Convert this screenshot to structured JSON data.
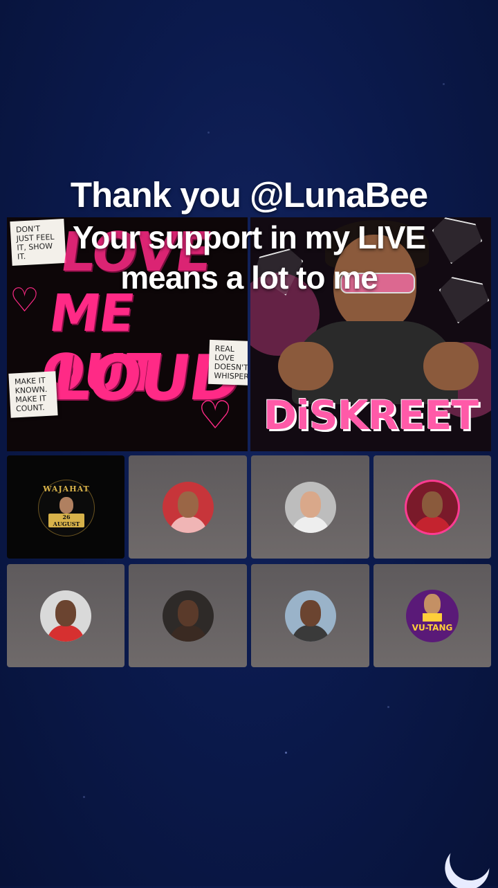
{
  "overlay": {
    "thank_you": "Thank you @LunaBee",
    "support_message": "Your support in my LIVE means a lot to me"
  },
  "left_tile": {
    "note_top": "DON'T JUST FEEL IT, SHOW IT.",
    "note_mid": "REAL LOVE DOESN'T WHISPER.",
    "note_bottom": "MAKE IT KNOWN. MAKE IT COUNT.",
    "headline_1": "LOVE",
    "headline_2": "ME OUT",
    "headline_3": "LOUD"
  },
  "right_tile": {
    "brand": "DiSKREET"
  },
  "guests": [
    {
      "type": "poster",
      "name": "WAJAHAT",
      "date": "26 AUGUST"
    },
    {
      "type": "avatar",
      "skin": "#9a6646",
      "top": "#f0b5b5",
      "bg": "#c7353a"
    },
    {
      "type": "avatar",
      "skin": "#d9a88a",
      "top": "#eeeeee",
      "bg": "#bdbdbd"
    },
    {
      "type": "avatar",
      "skin": "#8a5a3c",
      "top": "#c4232f",
      "bg": "#7a1a2a",
      "ring": true
    },
    {
      "type": "avatar",
      "skin": "#6b4430",
      "top": "#d63030",
      "bg": "#d9d9d9"
    },
    {
      "type": "avatar",
      "skin": "#5a3a2a",
      "top": "#3a2a22",
      "bg": "#2e2a28"
    },
    {
      "type": "avatar",
      "skin": "#6b4430",
      "top": "#3a3a3a",
      "bg": "#9ab3c9"
    },
    {
      "type": "wutang",
      "label": "VU-TANG"
    }
  ]
}
